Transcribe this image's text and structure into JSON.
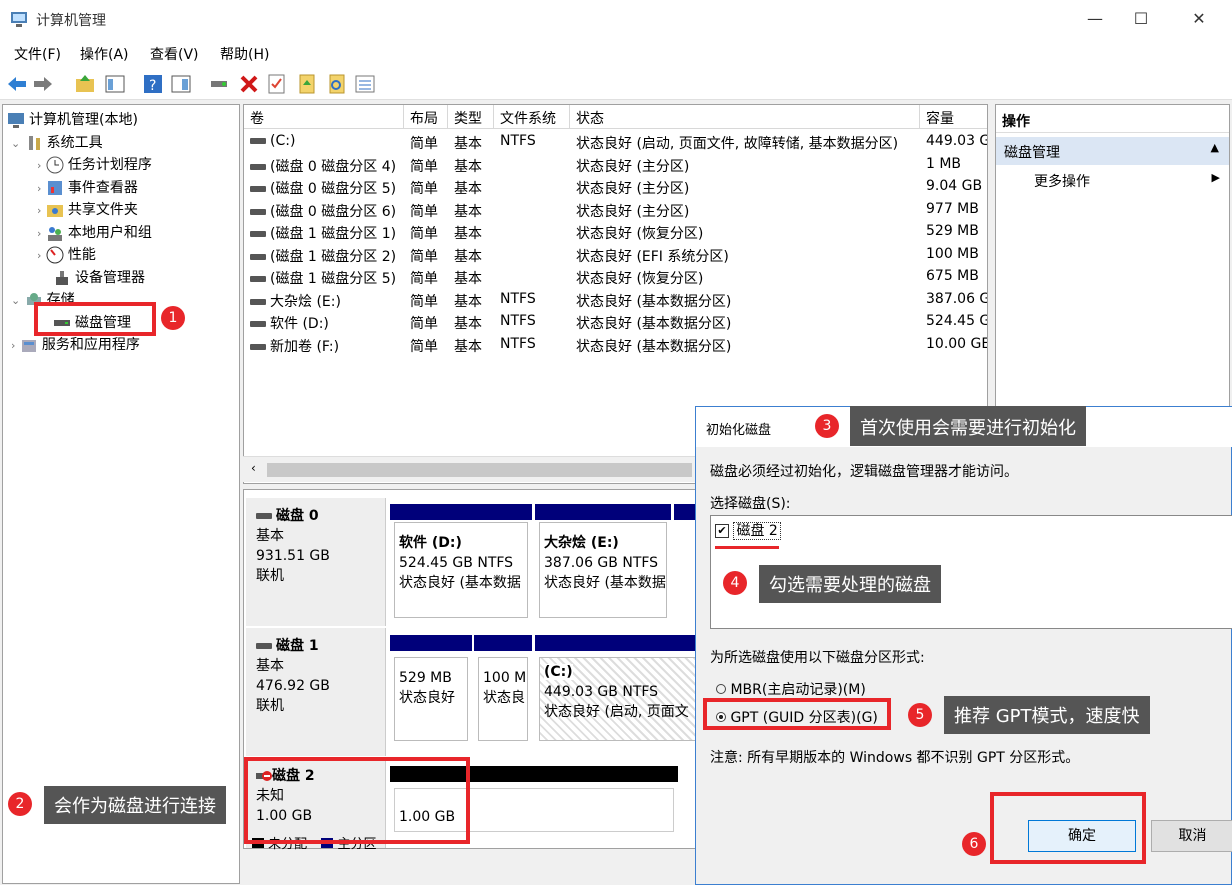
{
  "window": {
    "title": "计算机管理",
    "minimize": "—",
    "maximize": "☐",
    "close": "✕"
  },
  "menu": [
    "文件(F)",
    "操作(A)",
    "查看(V)",
    "帮助(H)"
  ],
  "tree": {
    "root": "计算机管理(本地)",
    "system_tools": "系统工具",
    "task_scheduler": "任务计划程序",
    "event_viewer": "事件查看器",
    "shared_folders": "共享文件夹",
    "local_users": "本地用户和组",
    "performance": "性能",
    "device_manager": "设备管理器",
    "storage": "存储",
    "disk_management": "磁盘管理",
    "services": "服务和应用程序"
  },
  "columns": [
    "卷",
    "布局",
    "类型",
    "文件系统",
    "状态",
    "容量"
  ],
  "volumes": [
    [
      "(C:)",
      "简单",
      "基本",
      "NTFS",
      "状态良好 (启动, 页面文件, 故障转储, 基本数据分区)",
      "449.03 G"
    ],
    [
      "(磁盘 0 磁盘分区 4)",
      "简单",
      "基本",
      "",
      "状态良好 (主分区)",
      "1 MB"
    ],
    [
      "(磁盘 0 磁盘分区 5)",
      "简单",
      "基本",
      "",
      "状态良好 (主分区)",
      "9.04 GB"
    ],
    [
      "(磁盘 0 磁盘分区 6)",
      "简单",
      "基本",
      "",
      "状态良好 (主分区)",
      "977 MB"
    ],
    [
      "(磁盘 1 磁盘分区 1)",
      "简单",
      "基本",
      "",
      "状态良好 (恢复分区)",
      "529 MB"
    ],
    [
      "(磁盘 1 磁盘分区 2)",
      "简单",
      "基本",
      "",
      "状态良好 (EFI 系统分区)",
      "100 MB"
    ],
    [
      "(磁盘 1 磁盘分区 5)",
      "简单",
      "基本",
      "",
      "状态良好 (恢复分区)",
      "675 MB"
    ],
    [
      "大杂烩 (E:)",
      "简单",
      "基本",
      "NTFS",
      "状态良好 (基本数据分区)",
      "387.06 G"
    ],
    [
      "软件 (D:)",
      "简单",
      "基本",
      "NTFS",
      "状态良好 (基本数据分区)",
      "524.45 G"
    ],
    [
      "新加卷 (F:)",
      "简单",
      "基本",
      "NTFS",
      "状态良好 (基本数据分区)",
      "10.00 GE"
    ]
  ],
  "disks": {
    "d0": {
      "name": "磁盘 0",
      "type": "基本",
      "size": "931.51 GB",
      "state": "联机",
      "p1": {
        "name": "软件  (D:)",
        "size": "524.45 GB NTFS",
        "status": "状态良好 (基本数据"
      },
      "p2": {
        "name": "大杂烩  (E:)",
        "size": "387.06 GB NTFS",
        "status": "状态良好 (基本数据"
      }
    },
    "d1": {
      "name": "磁盘 1",
      "type": "基本",
      "size": "476.92 GB",
      "state": "联机",
      "p1": {
        "size": "529 MB",
        "status": "状态良好"
      },
      "p2": {
        "size": "100 M",
        "status": "状态良"
      },
      "p3": {
        "name": "(C:)",
        "size": "449.03 GB NTFS",
        "status": "状态良好 (启动, 页面文"
      }
    },
    "d2": {
      "name": "磁盘 2",
      "type": "未知",
      "size": "1.00 GB",
      "part": "1.00 GB"
    },
    "legend": [
      "未分配",
      "主分区"
    ]
  },
  "actions": {
    "title": "操作",
    "section": "磁盘管理",
    "more": "更多操作"
  },
  "dialog": {
    "title": "初始化磁盘",
    "desc": "磁盘必须经过初始化，逻辑磁盘管理器才能访问。",
    "select_label": "选择磁盘(S):",
    "disk_item": "磁盘 2",
    "style_label": "为所选磁盘使用以下磁盘分区形式:",
    "mbr": "MBR(主启动记录)(M)",
    "gpt": "GPT (GUID 分区表)(G)",
    "note": "注意: 所有早期版本的 Windows 都不识别 GPT 分区形式。",
    "ok": "确定",
    "cancel": "取消"
  },
  "callouts": {
    "c1": "1",
    "c2_num": "2",
    "c2": "会作为磁盘进行连接",
    "c3_num": "3",
    "c3": "首次使用会需要进行初始化",
    "c4_num": "4",
    "c4": "勾选需要处理的磁盘",
    "c5_num": "5",
    "c5": "推荐 GPT模式，速度快",
    "c6_num": "6"
  }
}
